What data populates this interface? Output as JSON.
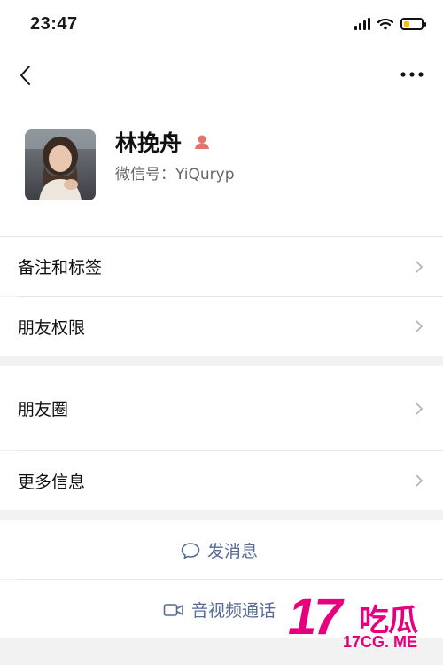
{
  "status_bar": {
    "time": "23:47",
    "battery_color": "#f4c400"
  },
  "nav": {
    "back_icon": "chevron-left-icon",
    "more_icon": "more-horizontal-icon"
  },
  "profile": {
    "name": "林挽舟",
    "wechat_id": "微信号：YiQuryp",
    "tag_icon": "user-tag-icon",
    "tag_color": "#e8726a"
  },
  "menu_section_1": [
    {
      "label": "备注和标签"
    },
    {
      "label": "朋友权限"
    }
  ],
  "menu_section_2": [
    {
      "label": "朋友圈"
    },
    {
      "label": "更多信息"
    }
  ],
  "actions": {
    "send_message": "发消息",
    "video_call": "音视频通话",
    "link_color": "#576b95"
  },
  "watermark": {
    "number": "17",
    "chinese": "吃瓜",
    "url": "17CG. ME",
    "color": "#e6007e"
  }
}
